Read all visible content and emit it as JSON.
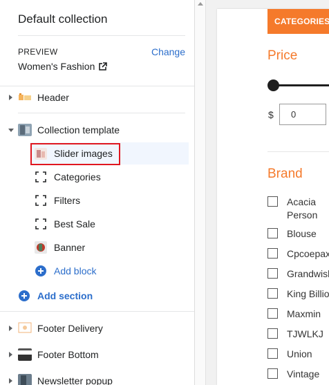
{
  "sidebar": {
    "title": "Default collection",
    "preview_label": "PREVIEW",
    "change_label": "Change",
    "preview_value": "Women's Fashion",
    "sections": [
      {
        "label": "Header",
        "icon": "header-thumb-icon",
        "expanded": false
      },
      {
        "label": "Collection template",
        "icon": "collection-thumb-icon",
        "expanded": true,
        "blocks": [
          {
            "label": "Slider images",
            "icon": "image-thumb-icon",
            "selected": true
          },
          {
            "label": "Categories",
            "icon": "dashed-block-icon"
          },
          {
            "label": "Filters",
            "icon": "dashed-block-icon"
          },
          {
            "label": "Best Sale",
            "icon": "dashed-block-icon"
          },
          {
            "label": "Banner",
            "icon": "banner-thumb-icon"
          }
        ],
        "add_block_label": "Add block"
      }
    ],
    "add_section_label": "Add section",
    "footer_sections": [
      {
        "label": "Footer Delivery",
        "icon": "footer-delivery-thumb-icon"
      },
      {
        "label": "Footer Bottom",
        "icon": "footer-bottom-thumb-icon"
      },
      {
        "label": "Newsletter popup",
        "icon": "newsletter-thumb-icon"
      }
    ]
  },
  "preview": {
    "categories_tab": "CATEGORIES",
    "price_title": "Price",
    "currency": "$",
    "price_min": "0",
    "brand_title": "Brand",
    "brands": [
      "Acacia Person",
      "Blouse",
      "Cpcoepax",
      "Grandwish",
      "King Billion",
      "Maxmin",
      "TJWLKJ",
      "Union",
      "Vintage"
    ]
  },
  "colors": {
    "accent": "#f57a2b",
    "link": "#2c6ecb",
    "highlight": "#e0161f"
  }
}
